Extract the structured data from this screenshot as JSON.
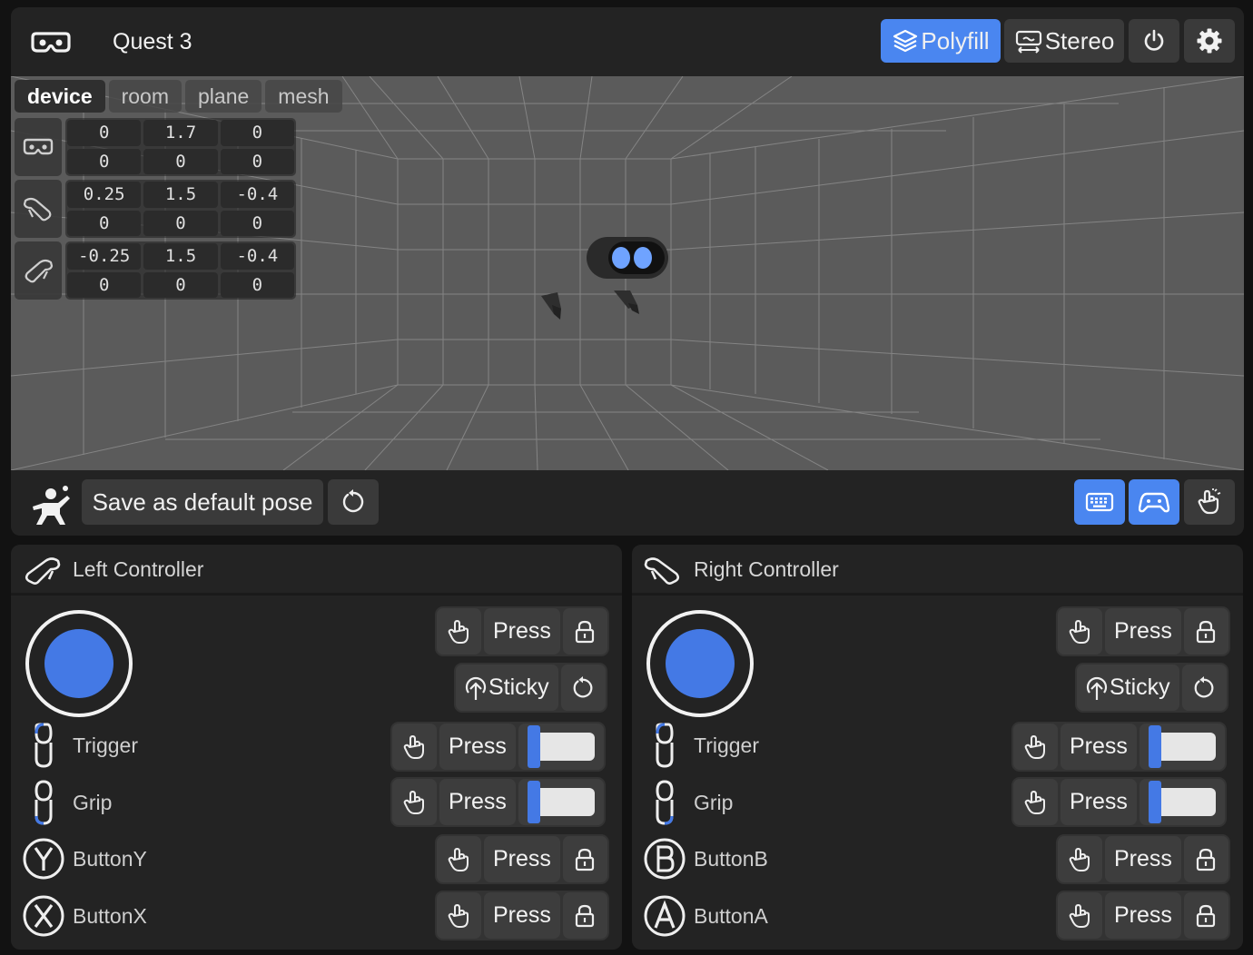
{
  "header": {
    "device_icon": "vr-headset-icon",
    "device_name": "Quest 3",
    "polyfill_label": "Polyfill",
    "stereo_label": "Stereo",
    "power_icon": "power-icon",
    "settings_icon": "gear-icon",
    "accent_color": "#4a86f0"
  },
  "tabs": [
    {
      "label": "device",
      "active": true
    },
    {
      "label": "room",
      "active": false
    },
    {
      "label": "plane",
      "active": false
    },
    {
      "label": "mesh",
      "active": false
    }
  ],
  "pose_table": [
    {
      "icon": "headset-icon",
      "position": [
        "0",
        "1.7",
        "0"
      ],
      "rotation": [
        "0",
        "0",
        "0"
      ]
    },
    {
      "icon": "right-controller-icon",
      "position": [
        "0.25",
        "1.5",
        "-0.4"
      ],
      "rotation": [
        "0",
        "0",
        "0"
      ]
    },
    {
      "icon": "left-controller-icon",
      "position": [
        "-0.25",
        "1.5",
        "-0.4"
      ],
      "rotation": [
        "0",
        "0",
        "0"
      ]
    }
  ],
  "toolbar": {
    "pose_icon": "person-pose-icon",
    "save_label": "Save as default pose",
    "reset_icon": "reset-icon",
    "keyboard_icon": "keyboard-icon",
    "gamepad_icon": "gamepad-icon",
    "hand_icon": "hand-gesture-icon"
  },
  "left_controller": {
    "title": "Left Controller",
    "press_label": "Press",
    "sticky_label": "Sticky",
    "inputs": [
      {
        "name": "Trigger",
        "icon": "trigger-icon",
        "value": 0.0
      },
      {
        "name": "Grip",
        "icon": "grip-icon",
        "value": 0.0
      },
      {
        "name": "ButtonY",
        "icon": "button-y-icon"
      },
      {
        "name": "ButtonX",
        "icon": "button-x-icon"
      }
    ]
  },
  "right_controller": {
    "title": "Right Controller",
    "press_label": "Press",
    "sticky_label": "Sticky",
    "inputs": [
      {
        "name": "Trigger",
        "icon": "trigger-icon",
        "value": 0.0
      },
      {
        "name": "Grip",
        "icon": "grip-icon",
        "value": 0.0
      },
      {
        "name": "ButtonB",
        "icon": "button-b-icon"
      },
      {
        "name": "ButtonA",
        "icon": "button-a-icon"
      }
    ]
  }
}
